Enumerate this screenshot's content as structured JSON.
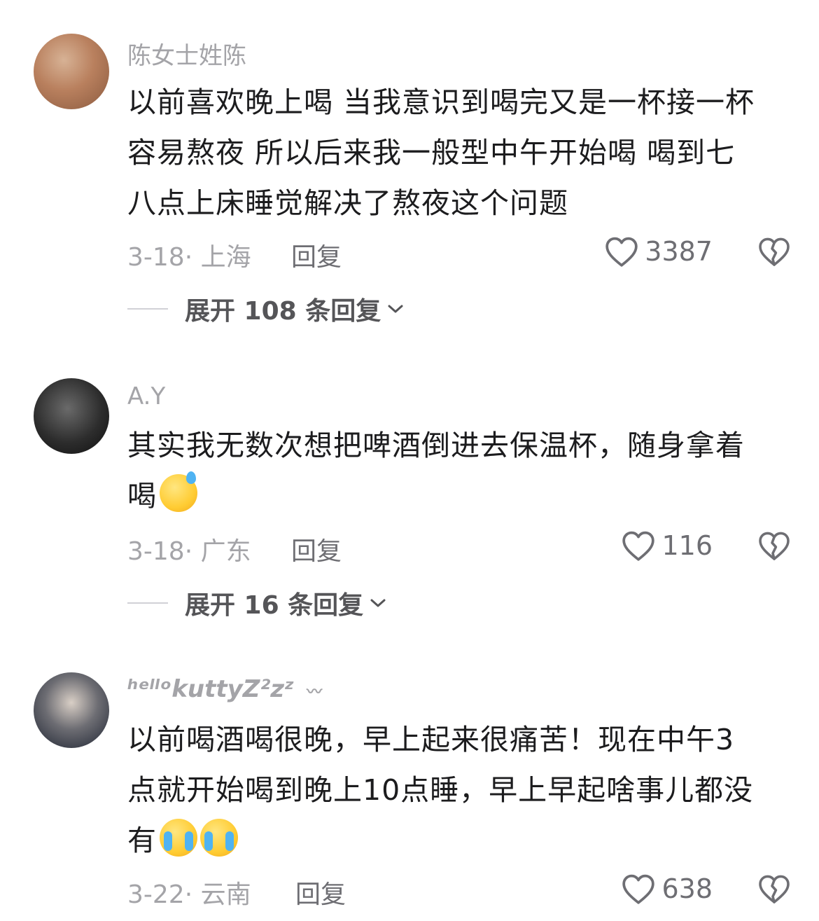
{
  "comments": [
    {
      "username": "陈女士姓陈",
      "lines": [
        "以前喜欢晚上喝 当我意识到喝完又是一杯接一杯",
        "容易熬夜 所以后来我一般型中午开始喝 喝到七",
        "八点上床睡觉解决了熬夜这个问题"
      ],
      "date_location": "3-18· 上海",
      "reply_label": "回复",
      "likes": "3387",
      "expand_label": "展开 108 条回复"
    },
    {
      "username": "A.Y",
      "lines": [
        "其实我无数次想把啤酒倒进去保温杯，随身拿着",
        "喝"
      ],
      "date_location": "3-18· 广东",
      "reply_label": "回复",
      "likes": "116",
      "expand_label": "展开 16 条回复"
    },
    {
      "username": "ʰᵉˡˡᵒkuttyZ²zᶻ",
      "lines": [
        "以前喝酒喝很晚，早上起来很痛苦！现在中午3",
        "点就开始喝到晚上10点睡，早上早起啥事儿都没",
        "有"
      ],
      "date_location": "3-22· 云南",
      "reply_label": "回复",
      "likes": "638"
    }
  ],
  "icons": {
    "like": "heart-outline-icon",
    "dislike": "broken-heart-icon",
    "expand": "chevron-down-icon"
  },
  "colors": {
    "text": "#1c1c1e",
    "secondary": "#a4a4a8",
    "action": "#6e6e73"
  }
}
